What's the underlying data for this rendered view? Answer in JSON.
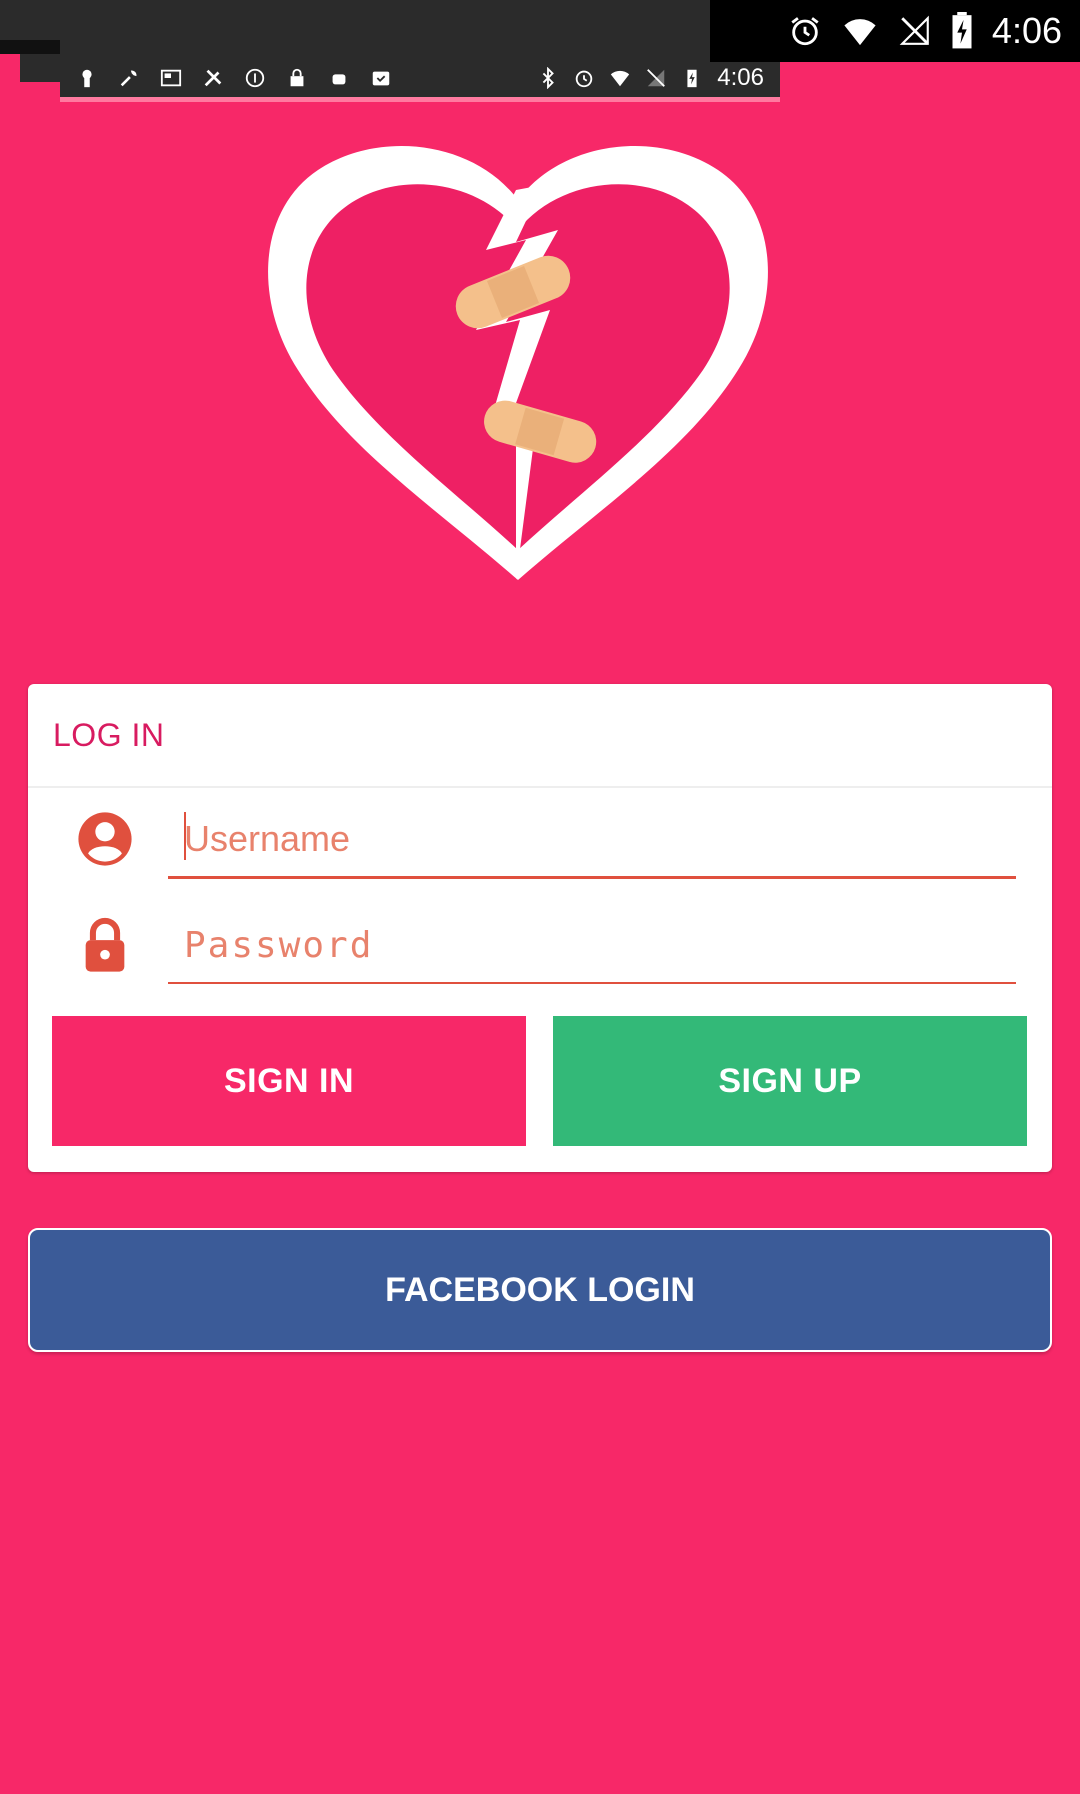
{
  "status_bar": {
    "time": "4:06",
    "inner_time": "4:06",
    "icons": [
      "bluetooth-icon",
      "alarm-icon",
      "wifi-icon",
      "no-signal-icon",
      "battery-charging-icon"
    ]
  },
  "colors": {
    "background": "#F72868",
    "accent": "#D81B60",
    "field_underline": "#E0503E",
    "signin": "#F72868",
    "signup": "#33B978",
    "facebook": "#3B5B98"
  },
  "login": {
    "title": "LOG IN",
    "username_placeholder": "Username",
    "password_placeholder": "Password",
    "signin_label": "SIGN IN",
    "signup_label": "SIGN UP"
  },
  "facebook_label": "FACEBOOK LOGIN"
}
